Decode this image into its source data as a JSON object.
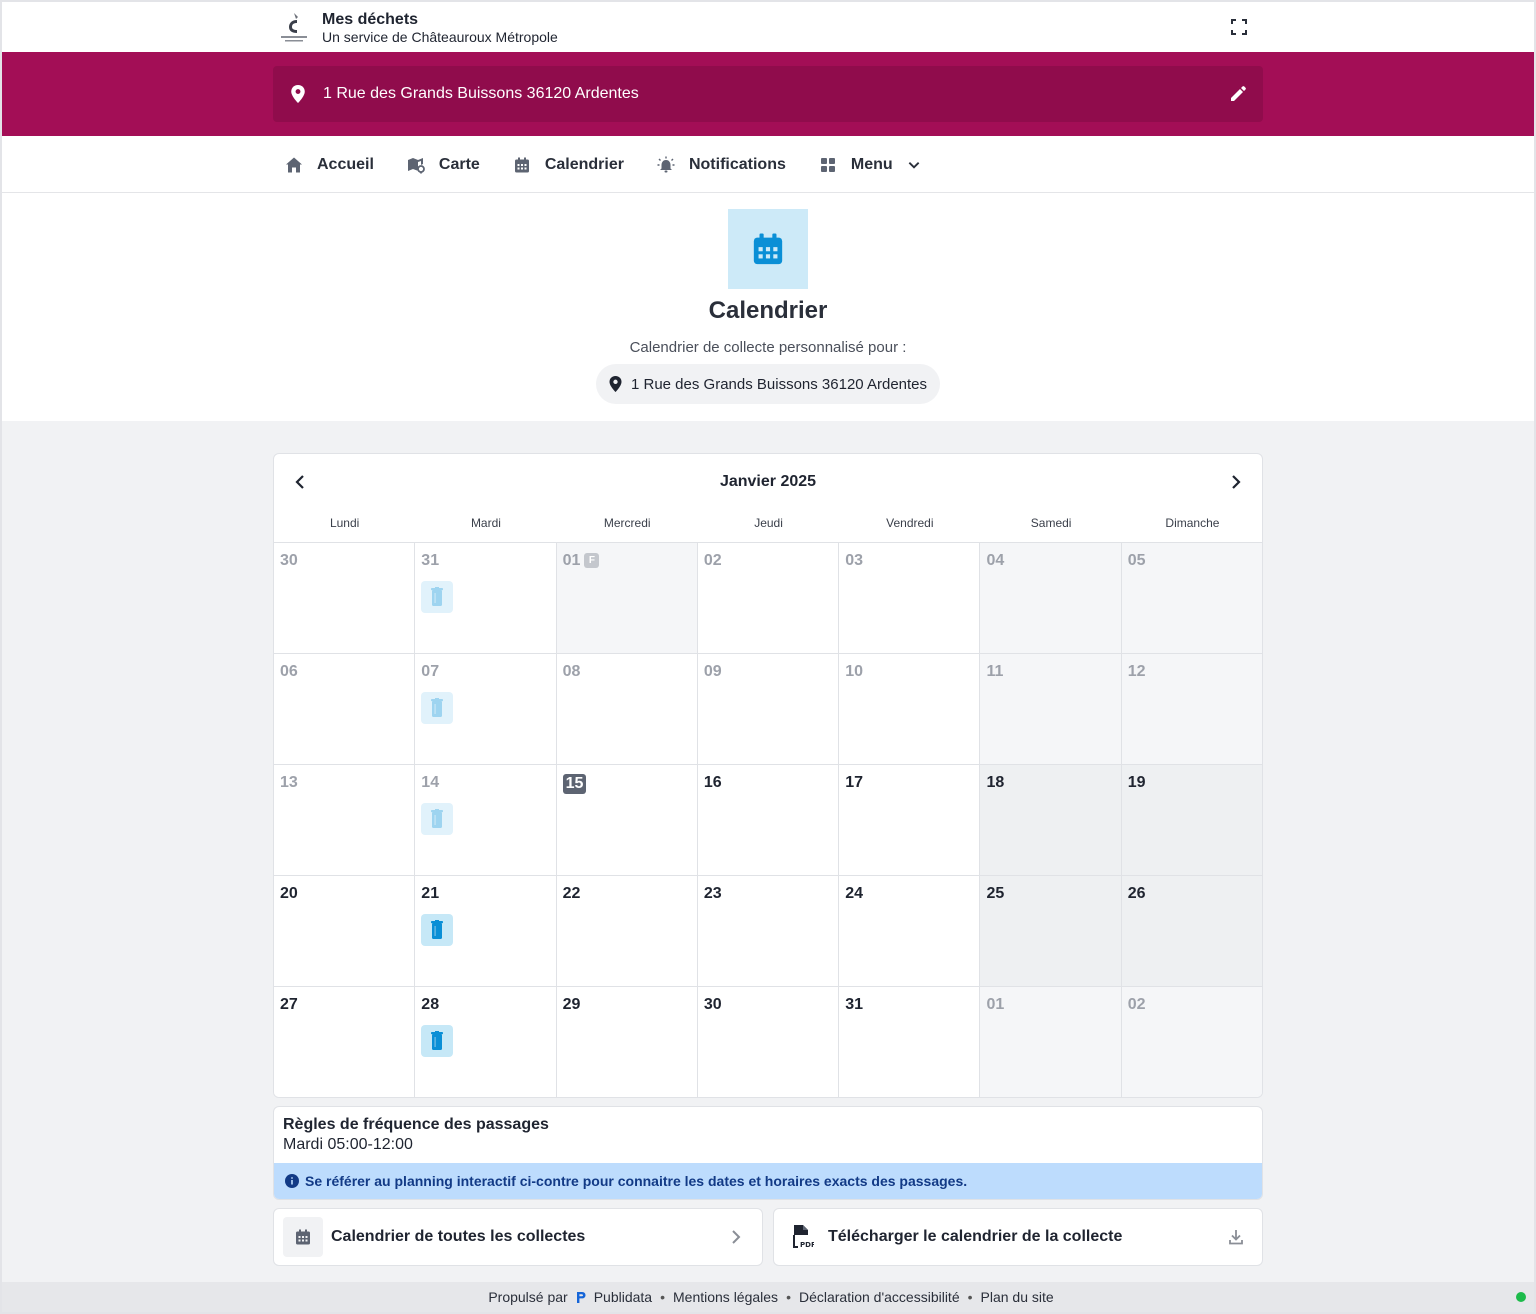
{
  "header": {
    "app_title": "Mes déchets",
    "app_subtitle": "Un service de Châteauroux Métropole"
  },
  "address": {
    "text": "1 Rue des Grands Buissons 36120 Ardentes"
  },
  "nav": {
    "items": [
      {
        "label": "Accueil",
        "icon": "home-icon"
      },
      {
        "label": "Carte",
        "icon": "map-icon"
      },
      {
        "label": "Calendrier",
        "icon": "calendar-icon"
      },
      {
        "label": "Notifications",
        "icon": "bell-icon"
      },
      {
        "label": "Menu",
        "icon": "grid-icon"
      }
    ]
  },
  "hero": {
    "title": "Calendrier",
    "subtitle": "Calendrier de collecte personnalisé pour :",
    "address": "1 Rue des Grands Buissons 36120 Ardentes"
  },
  "calendar": {
    "month_label": "Janvier 2025",
    "weekdays": [
      "Lundi",
      "Mardi",
      "Mercredi",
      "Jeudi",
      "Vendredi",
      "Samedi",
      "Dimanche"
    ],
    "holiday_badge": "F",
    "today": "15",
    "weeks": [
      [
        {
          "d": "30",
          "s": "other"
        },
        {
          "d": "31",
          "s": "other",
          "bin": "faded"
        },
        {
          "d": "01",
          "s": "past",
          "holiday": true
        },
        {
          "d": "02",
          "s": "past"
        },
        {
          "d": "03",
          "s": "past"
        },
        {
          "d": "04",
          "s": "past",
          "we": true
        },
        {
          "d": "05",
          "s": "past",
          "we": true
        }
      ],
      [
        {
          "d": "06",
          "s": "past"
        },
        {
          "d": "07",
          "s": "past",
          "bin": "faded"
        },
        {
          "d": "08",
          "s": "past"
        },
        {
          "d": "09",
          "s": "past"
        },
        {
          "d": "10",
          "s": "past"
        },
        {
          "d": "11",
          "s": "past",
          "we": true
        },
        {
          "d": "12",
          "s": "past",
          "we": true
        }
      ],
      [
        {
          "d": "13",
          "s": "past"
        },
        {
          "d": "14",
          "s": "past",
          "bin": "faded"
        },
        {
          "d": "15",
          "s": "today"
        },
        {
          "d": "16",
          "s": "cur"
        },
        {
          "d": "17",
          "s": "cur"
        },
        {
          "d": "18",
          "s": "cur",
          "we": true
        },
        {
          "d": "19",
          "s": "cur",
          "we": true
        }
      ],
      [
        {
          "d": "20",
          "s": "cur"
        },
        {
          "d": "21",
          "s": "cur",
          "bin": "active"
        },
        {
          "d": "22",
          "s": "cur"
        },
        {
          "d": "23",
          "s": "cur"
        },
        {
          "d": "24",
          "s": "cur"
        },
        {
          "d": "25",
          "s": "cur",
          "we": true
        },
        {
          "d": "26",
          "s": "cur",
          "we": true
        }
      ],
      [
        {
          "d": "27",
          "s": "cur"
        },
        {
          "d": "28",
          "s": "cur",
          "bin": "active"
        },
        {
          "d": "29",
          "s": "cur"
        },
        {
          "d": "30",
          "s": "cur"
        },
        {
          "d": "31",
          "s": "cur"
        },
        {
          "d": "01",
          "s": "other",
          "we": true
        },
        {
          "d": "02",
          "s": "other",
          "we": true
        }
      ]
    ]
  },
  "rules": {
    "title": "Règles de fréquence des passages",
    "value": "Mardi 05:00-12:00",
    "info": "Se référer au planning interactif ci-contre pour connaitre les dates et horaires exacts des passages."
  },
  "actions": {
    "all_collections": "Calendrier de toutes les collectes",
    "download": "Télécharger le calendrier de la collecte"
  },
  "footer": {
    "powered_by": "Propulsé par",
    "brand": "Publidata",
    "legal": "Mentions légales",
    "accessibility": "Déclaration d'accessibilité",
    "sitemap": "Plan du site"
  },
  "colors": {
    "brand": "#a30e56",
    "brand_dark": "#900c4c",
    "accent": "#0a8fd6",
    "info_bg": "#bddcfd"
  }
}
